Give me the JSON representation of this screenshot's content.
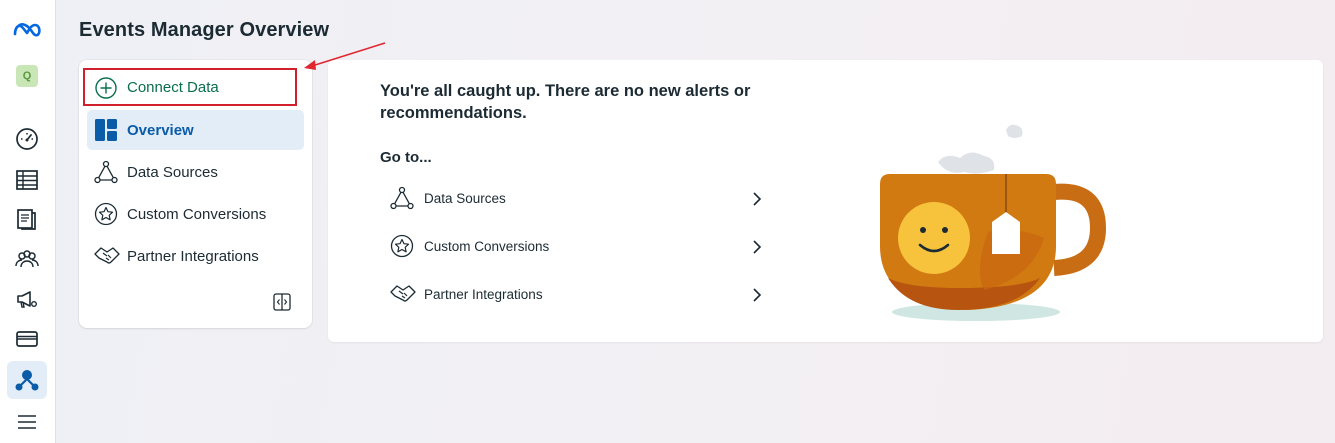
{
  "page": {
    "title": "Events Manager Overview"
  },
  "rail": {
    "avatar_letter": "Q",
    "items": [
      {
        "icon": "meta-logo-icon"
      },
      {
        "icon": "account-avatar"
      },
      {
        "icon": "dashboard-gauge-icon"
      },
      {
        "icon": "table-icon"
      },
      {
        "icon": "pages-icon"
      },
      {
        "icon": "audiences-icon"
      },
      {
        "icon": "ads-megaphone-icon"
      },
      {
        "icon": "billing-card-icon"
      },
      {
        "icon": "events-manager-icon",
        "active": true
      },
      {
        "icon": "menu-icon"
      }
    ]
  },
  "sidebar": {
    "connect_label": "Connect Data",
    "items": [
      {
        "label": "Overview",
        "icon": "overview-grid-icon",
        "active": true
      },
      {
        "label": "Data Sources",
        "icon": "data-sources-icon"
      },
      {
        "label": "Custom Conversions",
        "icon": "star-badge-icon"
      },
      {
        "label": "Partner Integrations",
        "icon": "handshake-icon"
      }
    ],
    "collapse_icon": "collapse-panel-icon"
  },
  "main": {
    "alert": "You're all caught up. There are no new alerts or recommendations.",
    "goto_label": "Go to...",
    "links": [
      {
        "label": "Data Sources",
        "icon": "data-sources-icon"
      },
      {
        "label": "Custom Conversions",
        "icon": "star-badge-icon"
      },
      {
        "label": "Partner Integrations",
        "icon": "handshake-icon"
      }
    ],
    "illustration": "tea-cup-smiley"
  },
  "colors": {
    "connect_highlight": "#d0202b",
    "connect_text": "#0a6e4e",
    "active_bg": "#e2edf7",
    "active_text": "#0a5ba8",
    "meta_blue": "#0668e1"
  }
}
